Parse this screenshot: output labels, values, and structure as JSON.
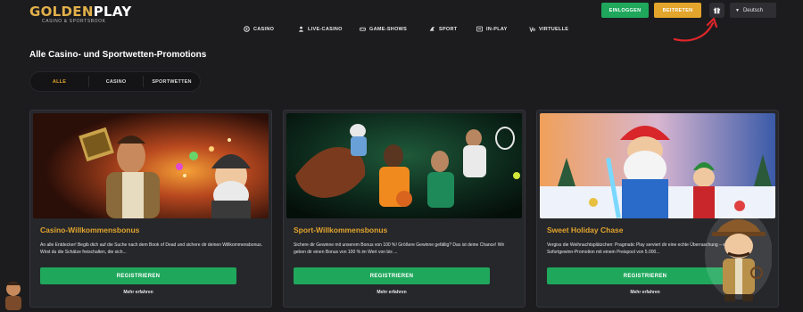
{
  "header": {
    "logo_gold": "GOLDEN",
    "logo_white": "PLAY",
    "logo_sub": "CASINO & SPORTSBOOK",
    "login_label": "EINLOGGEN",
    "join_label": "BEITRETEN",
    "language": "Deutsch"
  },
  "nav": [
    {
      "label": "CASINO",
      "icon": "casino-chip-icon"
    },
    {
      "label": "LIVE-CASINO",
      "icon": "live-person-icon"
    },
    {
      "label": "GAME-SHOWS",
      "icon": "gamepad-icon"
    },
    {
      "label": "SPORT",
      "icon": "sport-icon"
    },
    {
      "label": "IN-PLAY",
      "icon": "in-play-icon"
    },
    {
      "label": "VIRTUELLE",
      "icon": "virtual-icon"
    }
  ],
  "page_title": "Alle Casino- und Sportwetten-Promotions",
  "filters": [
    {
      "label": "ALLE",
      "active": true
    },
    {
      "label": "CASINO",
      "active": false
    },
    {
      "label": "SPORTWETTEN",
      "active": false
    }
  ],
  "cards": [
    {
      "title": "Casino-Willkommensbonus",
      "desc": "An alle Entdecker! Begib dich auf die Suche nach dem Book of Dead und sichere dir deinen Willkommensbonus. Wirst du die Schätze freischalten, die sich...",
      "button": "REGISTRIEREN",
      "more": "Mehr erfahren"
    },
    {
      "title": "Sport-Willkommensbonus",
      "desc": "Sichere dir Gewinne mit unserem Bonus von 100 %! Größere Gewinne gefällig? Das ist deine Chance! Wir geben dir einen Bonus von 100 % im Wert von bis ...",
      "button": "REGISTRIEREN",
      "more": "Mehr erfahren"
    },
    {
      "title": "Sweet Holiday Chase",
      "desc": "Vergiss die Weihnachtsplätzchen: Pragmatic Play serviert dir eine echte Überraschung – eine neue Sofortgewinn-Promotion mit einem Preispool von 5.000...",
      "button": "REGISTRIEREN",
      "more": "Mehr erfahren"
    }
  ],
  "colors": {
    "background": "#1c1c1f",
    "accent_gold": "#e3a52c",
    "accent_green": "#1fa85c",
    "card_bg": "#26272b",
    "annotation_red": "#e0262a"
  }
}
